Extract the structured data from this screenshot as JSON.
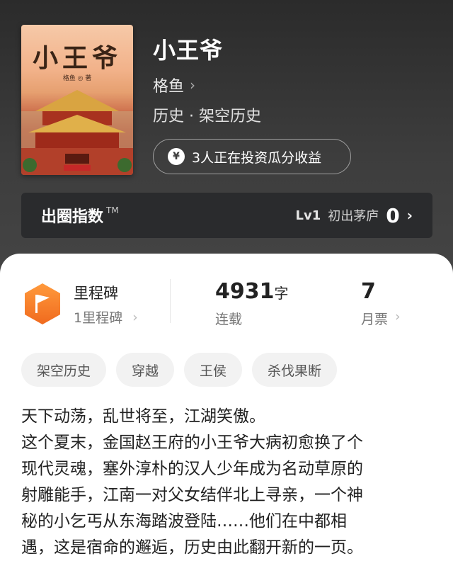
{
  "book": {
    "cover_title": "小王爷",
    "cover_author": "格鱼 ◎ 著",
    "title": "小王爷",
    "author": "格鱼",
    "genre": "历史 · 架空历史",
    "invest_text": "3人正在投资瓜分收益"
  },
  "index": {
    "title": "出圈指数",
    "tm": "TM",
    "level": "Lv1",
    "level_name": "初出茅庐",
    "value": "0"
  },
  "stats": {
    "milestone_label": "里程碑",
    "milestone_count": "1里程碑",
    "word_count": "4931",
    "word_unit": "字",
    "status": "连载",
    "monthly_tickets": "7",
    "monthly_label": "月票"
  },
  "tags": [
    "架空历史",
    "穿越",
    "王侯",
    "杀伐果断"
  ],
  "description": [
    "天下动荡，乱世将至，江湖笑傲。",
    "这个夏末，金国赵王府的小王爷大病初愈换了个",
    "现代灵魂，塞外淳朴的汉人少年成为名动草原的",
    "射雕能手，江南一对父女结伴北上寻亲，一个神",
    "秘的小乞丐从东海踏波登陆……他们在中都相",
    "遇，这是宿命的邂逅，历史由此翻开新的一页。"
  ],
  "icons": {
    "milestone": "flag-hexagon-icon",
    "invest": "yen-circle-icon",
    "chevron": "chevron-right-icon"
  },
  "colors": {
    "accent_orange": "#f5802a",
    "hero_bg": "#3d3d3d",
    "index_bar": "#2a2b2d"
  }
}
